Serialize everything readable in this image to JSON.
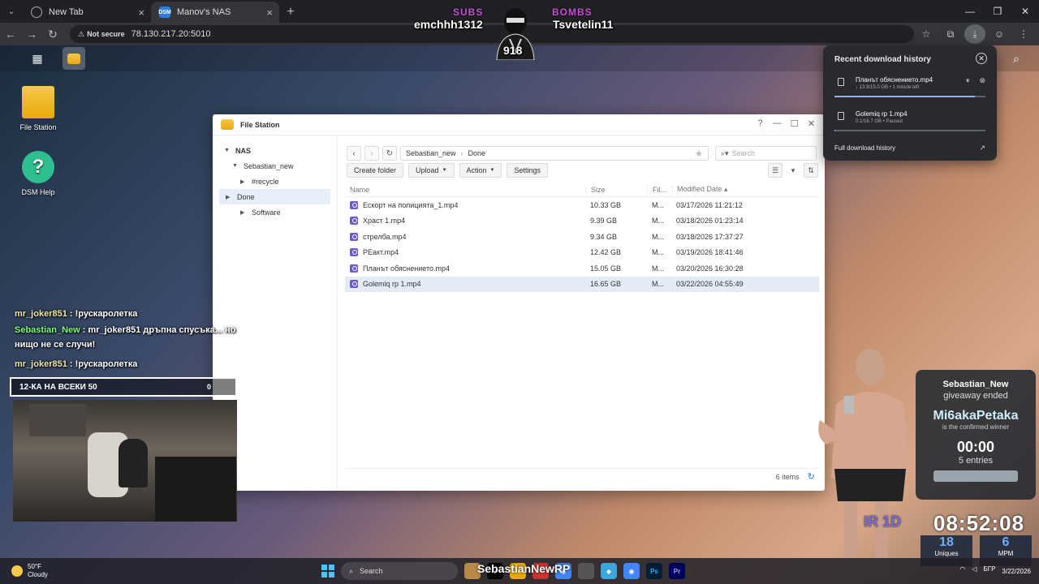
{
  "browser": {
    "tabs": [
      {
        "label": "New Tab"
      },
      {
        "label": "Manov's NAS"
      }
    ],
    "address": "78.130.217.20:5010",
    "not_secure": "Not secure"
  },
  "desktop": {
    "icons": [
      {
        "label": "File Station"
      },
      {
        "label": "DSM Help"
      }
    ]
  },
  "file_station": {
    "title": "File Station",
    "tree": {
      "root": "NAS",
      "share": "Sebastian_new",
      "folders": [
        "#recycle",
        "Done",
        "Software"
      ]
    },
    "path": {
      "part1": "Sebastian_new",
      "part2": "Done"
    },
    "search_placeholder": "Search",
    "actions": {
      "create": "Create folder",
      "upload": "Upload",
      "action": "Action",
      "settings": "Settings"
    },
    "columns": {
      "name": "Name",
      "size": "Size",
      "file_type": "Fil...",
      "modified": "Modified Date"
    },
    "files": [
      {
        "name": "Ескорт на полицията_1.mp4",
        "size": "10.33 GB",
        "type": "M...",
        "modified": "03/17/2026 11:21:12"
      },
      {
        "name": "Храст 1.mp4",
        "size": "9.39 GB",
        "type": "M...",
        "modified": "03/18/2026 01:23:14"
      },
      {
        "name": "стрелба.mp4",
        "size": "9.34 GB",
        "type": "M...",
        "modified": "03/18/2026 17:37:27"
      },
      {
        "name": "РЕакт.mp4",
        "size": "12.42 GB",
        "type": "M...",
        "modified": "03/19/2026 18:41:46"
      },
      {
        "name": "Планът обяснението.mp4",
        "size": "15.05 GB",
        "type": "M...",
        "modified": "03/20/2026 16:30:28"
      },
      {
        "name": "Golemiq rp 1.mp4",
        "size": "16.65 GB",
        "type": "M...",
        "modified": "03/22/2026 04:55:49"
      }
    ],
    "item_count": "6 items"
  },
  "downloads": {
    "heading": "Recent download history",
    "items": [
      {
        "name": "Планът обяснението.mp4",
        "status": "↓ 13.9/15.0 GB • 1 minute left",
        "progress": 0.93
      },
      {
        "name": "Golemiq rp 1.mp4",
        "status": "0.1/16.7 GB • Paused",
        "progress": 0.006
      }
    ],
    "full_history": "Full download history"
  },
  "stream": {
    "subs_label": "SUBS",
    "bombs_label": "BOMBS",
    "subs_user": "emchhh1312",
    "bombs_user": "Tsvetelin11",
    "counter": "918",
    "chat": [
      {
        "user": "mr_joker851",
        "text": ": !рускаролетка"
      },
      {
        "user": "Sebastian_New",
        "text": ": mr_joker851 дръпна спусъка... но"
      },
      {
        "user": "",
        "text": "нищо не се случи!"
      },
      {
        "user": "mr_joker851",
        "text": ": !рускаролетка"
      }
    ],
    "goal": "12-КА НА ВСЕКИ 50",
    "goal_count": "0",
    "giveaway": {
      "host": "Sebastian_New",
      "status": "giveaway ended",
      "winner": "Mi6akaPetaka",
      "confirm": "is the confirmed winner",
      "timer": "00:00",
      "entries": "5 entries"
    },
    "timer_prefix": "IR 1D",
    "clock": "08:52:08",
    "uniques": {
      "value": "18",
      "label": "Uniques"
    },
    "mpm": {
      "value": "6",
      "label": "MPM"
    },
    "overlay_name": "SebastianNewRP"
  },
  "taskbar": {
    "temp": "50°F",
    "weather": "Cloudy",
    "search": "Search",
    "lang": "БГР",
    "date": "3/22/2026"
  }
}
